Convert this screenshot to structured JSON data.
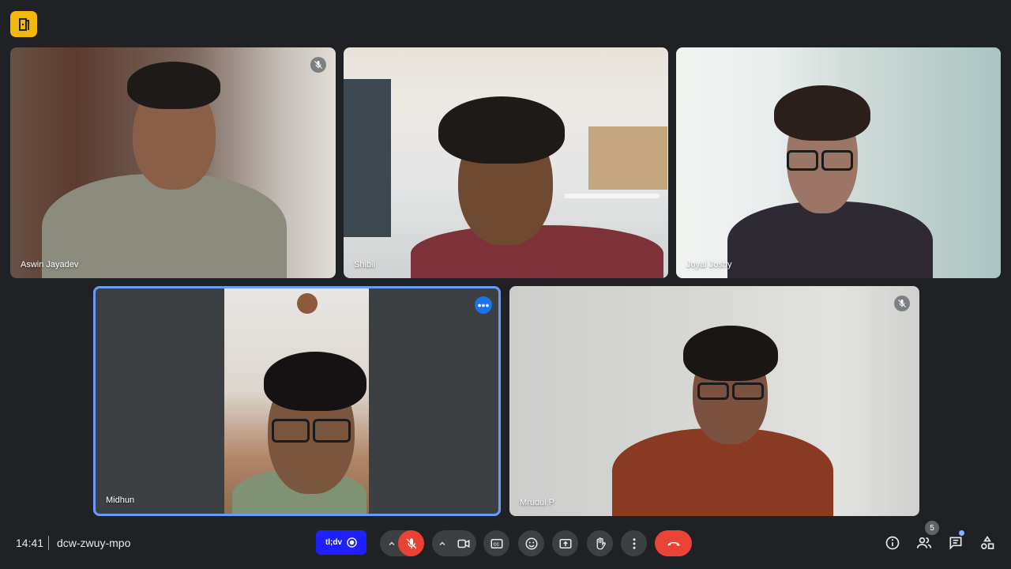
{
  "meeting": {
    "time": "14:41",
    "code": "dcw-zwuy-mpo"
  },
  "participants": [
    {
      "name": "Aswin Jayadev",
      "muted": true
    },
    {
      "name": "Shibil",
      "muted": false
    },
    {
      "name": "Joyal Joshy",
      "muted": false
    },
    {
      "name": "Midhun",
      "muted": false,
      "pinned": true
    },
    {
      "name": "Mrudul P",
      "muted": true
    }
  ],
  "controls": {
    "tldv_label": "tl;dv",
    "people_count": "5"
  },
  "colors": {
    "background": "#202124",
    "button": "#3c4043",
    "danger": "#ea4335",
    "accent": "#1a73e8",
    "logo": "#f6b70b"
  },
  "icons": [
    "door-logo-icon",
    "mic-off-icon",
    "more-options-icon",
    "chevron-up-icon",
    "camera-icon",
    "captions-icon",
    "emoji-icon",
    "present-icon",
    "raise-hand-icon",
    "more-vert-icon",
    "end-call-icon",
    "info-icon",
    "people-icon",
    "chat-icon",
    "activities-icon"
  ]
}
